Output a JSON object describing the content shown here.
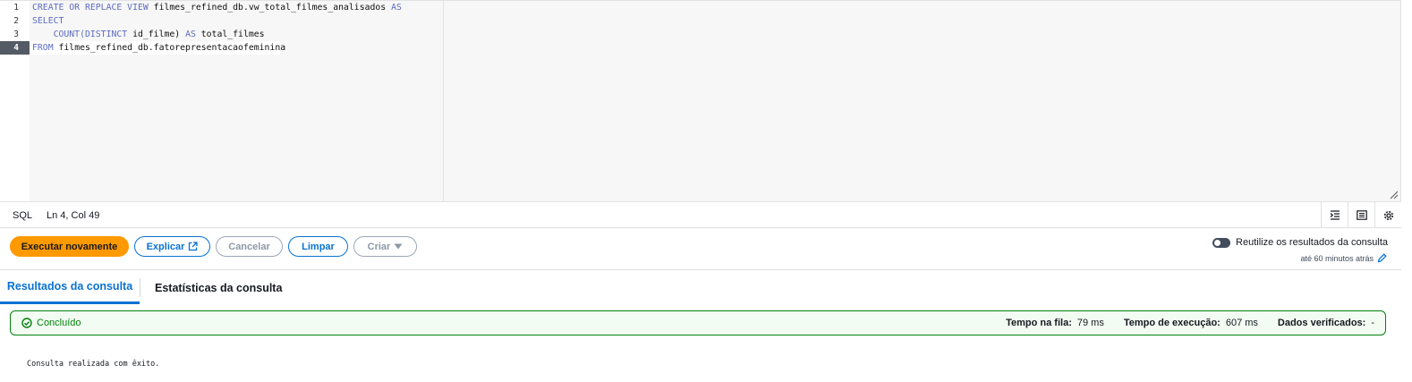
{
  "editor": {
    "line_numbers": [
      "1",
      "2",
      "3",
      "4"
    ],
    "active_line": "4",
    "lines": [
      {
        "kw1": "CREATE OR REPLACE VIEW ",
        "text": "filmes_refined_db.vw_total_filmes_analisados ",
        "kw2": "AS"
      },
      {
        "kw1": "SELECT",
        "text": "",
        "kw2": ""
      },
      {
        "indent": "    ",
        "fn": "COUNT(",
        "kw1": "DISTINCT ",
        "text": "id_filme) ",
        "kw2": "AS ",
        "tail": "total_filmes"
      },
      {
        "kw1": "FROM ",
        "text": "filmes_refined_db.fatorepresentacaofeminina",
        "kw2": ""
      }
    ]
  },
  "statusbar": {
    "language": "SQL",
    "cursor": "Ln 4, Col 49",
    "icons": [
      "indent-icon",
      "panel-icon",
      "gear-icon"
    ]
  },
  "toolbar": {
    "run_again": "Executar novamente",
    "explain": "Explicar",
    "cancel": "Cancelar",
    "clear": "Limpar",
    "create": "Criar",
    "reuse_label": "Reutilize os resultados da consulta",
    "reuse_sub": "até 60 minutos atrás"
  },
  "tabs": {
    "results": "Resultados da consulta",
    "stats": "Estatísticas da consulta"
  },
  "status": {
    "state": "Concluído",
    "queue_label": "Tempo na fila:",
    "queue_value": "79 ms",
    "exec_label": "Tempo de execução:",
    "exec_value": "607 ms",
    "verified_label": "Dados verificados:",
    "verified_value": "-"
  },
  "message": "Consulta realizada com êxito.",
  "colors": {
    "primary": "#ff9900",
    "link": "#0972d3",
    "success": "#037f0c"
  }
}
